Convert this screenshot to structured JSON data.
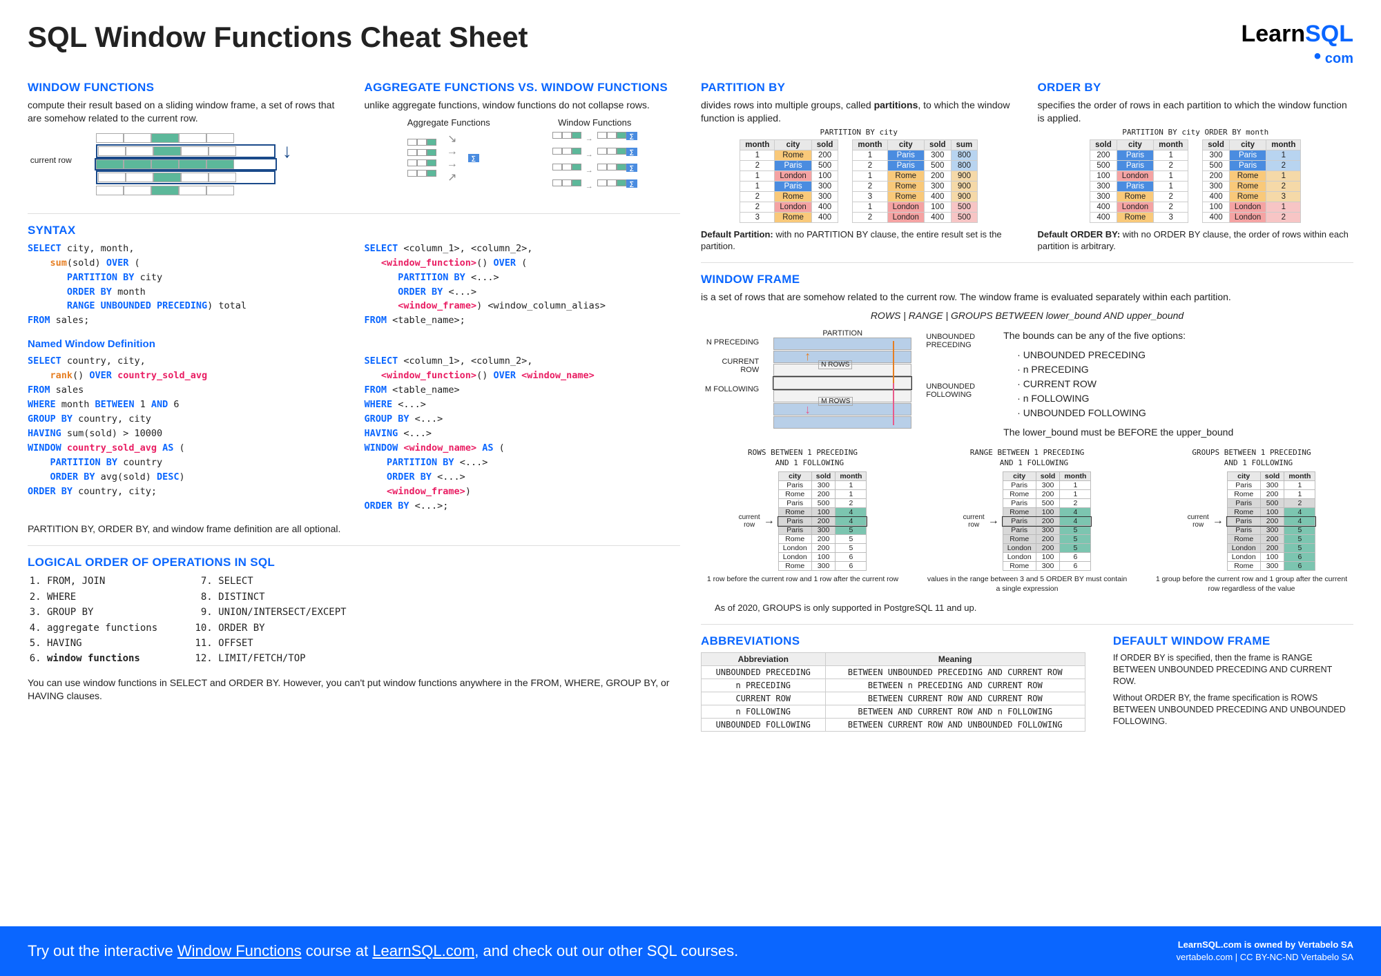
{
  "title": "SQL Window Functions Cheat Sheet",
  "logo": {
    "learn": "Learn",
    "sql": "SQL",
    "com": ".com"
  },
  "wf": {
    "heading": "WINDOW FUNCTIONS",
    "desc": "compute their result based on a sliding window frame, a set of rows that are somehow related to the current row.",
    "current_row": "current row"
  },
  "agg": {
    "heading": "AGGREGATE FUNCTIONS VS. WINDOW FUNCTIONS",
    "desc": "unlike aggregate functions, window functions do not collapse rows.",
    "agg_title": "Aggregate Functions",
    "win_title": "Window Functions"
  },
  "syntax": {
    "heading": "SYNTAX",
    "named_heading": "Named Window Definition",
    "note": "PARTITION BY, ORDER BY, and window frame definition are all optional."
  },
  "logical": {
    "heading": "LOGICAL ORDER OF OPERATIONS IN SQL",
    "ops1": [
      "FROM, JOIN",
      "WHERE",
      "GROUP BY",
      "aggregate functions",
      "HAVING",
      "window functions"
    ],
    "ops2": [
      "SELECT",
      "DISTINCT",
      "UNION/INTERSECT/EXCEPT",
      "ORDER BY",
      "OFFSET",
      "LIMIT/FETCH/TOP"
    ],
    "note": "You can use window functions in SELECT and ORDER BY. However, you can't put window functions anywhere in the FROM, WHERE, GROUP BY, or HAVING clauses."
  },
  "partition": {
    "heading": "PARTITION BY",
    "desc_pre": "divides rows into multiple groups, called ",
    "desc_bold": "partitions",
    "desc_post": ", to which the window function is applied.",
    "caption": "PARTITION BY city",
    "t1_head": [
      "month",
      "city",
      "sold"
    ],
    "t1_rows": [
      [
        "1",
        "Rome",
        "200"
      ],
      [
        "2",
        "Paris",
        "500"
      ],
      [
        "1",
        "London",
        "100"
      ],
      [
        "1",
        "Paris",
        "300"
      ],
      [
        "2",
        "Rome",
        "300"
      ],
      [
        "2",
        "London",
        "400"
      ],
      [
        "3",
        "Rome",
        "400"
      ]
    ],
    "t2_head": [
      "month",
      "city",
      "sold",
      "sum"
    ],
    "t2_rows": [
      [
        "1",
        "Paris",
        "300",
        "800"
      ],
      [
        "2",
        "Paris",
        "500",
        "800"
      ],
      [
        "1",
        "Rome",
        "200",
        "900"
      ],
      [
        "2",
        "Rome",
        "300",
        "900"
      ],
      [
        "3",
        "Rome",
        "400",
        "900"
      ],
      [
        "1",
        "London",
        "100",
        "500"
      ],
      [
        "2",
        "London",
        "400",
        "500"
      ]
    ],
    "default_b": "Default Partition:",
    "default_t": " with no PARTITION BY clause, the entire result set is the partition."
  },
  "orderby": {
    "heading": "ORDER BY",
    "desc": "specifies the order of rows in each partition to which the window function is applied.",
    "caption": "PARTITION BY city ORDER BY month",
    "t1_head": [
      "sold",
      "city",
      "month"
    ],
    "t1_rows": [
      [
        "200",
        "Paris",
        "1"
      ],
      [
        "500",
        "Paris",
        "2"
      ],
      [
        "100",
        "London",
        "1"
      ],
      [
        "300",
        "Paris",
        "1"
      ],
      [
        "300",
        "Rome",
        "2"
      ],
      [
        "400",
        "London",
        "2"
      ],
      [
        "400",
        "Rome",
        "3"
      ]
    ],
    "t2_rows": [
      [
        "300",
        "Paris",
        "1"
      ],
      [
        "500",
        "Paris",
        "2"
      ],
      [
        "200",
        "Rome",
        "1"
      ],
      [
        "300",
        "Rome",
        "2"
      ],
      [
        "400",
        "Rome",
        "3"
      ],
      [
        "100",
        "London",
        "1"
      ],
      [
        "400",
        "London",
        "2"
      ]
    ],
    "default_b": "Default ORDER BY:",
    "default_t": " with no ORDER BY clause, the order of rows within each partition is arbitrary."
  },
  "frame": {
    "heading": "WINDOW FRAME",
    "desc": "is a set of rows that are somehow related to the current row. The window frame is evaluated separately within each partition.",
    "syntax_line": "ROWS | RANGE | GROUPS BETWEEN lower_bound AND upper_bound",
    "bounds_intro": "The bounds can be any of the five options:",
    "bounds": [
      "UNBOUNDED PRECEDING",
      "n PRECEDING",
      "CURRENT ROW",
      "n FOLLOWING",
      "UNBOUNDED FOLLOWING"
    ],
    "bounds_note": "The lower_bound must be BEFORE the upper_bound",
    "diag_labels": {
      "partition": "PARTITION",
      "unb_prec": "UNBOUNDED\nPRECEDING",
      "n_prec": "N PRECEDING",
      "nrows": "N ROWS",
      "current": "CURRENT\nROW",
      "mrows": "M ROWS",
      "m_fol": "M FOLLOWING",
      "unb_fol": "UNBOUNDED\nFOLLOWING"
    },
    "ex_head": [
      "city",
      "sold",
      "month"
    ],
    "ex_rows": [
      [
        "Paris",
        "300",
        "1"
      ],
      [
        "Rome",
        "200",
        "1"
      ],
      [
        "Paris",
        "500",
        "2"
      ],
      [
        "Rome",
        "100",
        "4"
      ],
      [
        "Paris",
        "200",
        "4"
      ],
      [
        "Paris",
        "300",
        "5"
      ],
      [
        "Rome",
        "200",
        "5"
      ],
      [
        "London",
        "200",
        "5"
      ],
      [
        "London",
        "100",
        "6"
      ],
      [
        "Rome",
        "300",
        "6"
      ]
    ],
    "current_row_label": "current\nrow",
    "rows_title": "ROWS BETWEEN 1 PRECEDING\n   AND 1 FOLLOWING",
    "rows_note": "1 row before the current row and 1 row after the current row",
    "range_title": "RANGE BETWEEN 1 PRECEDING\n   AND 1 FOLLOWING",
    "range_note": "values in the range between 3 and 5 ORDER BY must contain a single expression",
    "groups_title": "GROUPS BETWEEN 1 PRECEDING\n   AND 1 FOLLOWING",
    "groups_note": "1 group before the current row and 1 group after the current row regardless of the value",
    "asof": "As of 2020, GROUPS is only supported in PostgreSQL 11 and up."
  },
  "abbrev": {
    "heading": "ABBREVIATIONS",
    "head": [
      "Abbreviation",
      "Meaning"
    ],
    "rows": [
      [
        "UNBOUNDED PRECEDING",
        "BETWEEN UNBOUNDED PRECEDING AND CURRENT ROW"
      ],
      [
        "n PRECEDING",
        "BETWEEN n PRECEDING AND CURRENT ROW"
      ],
      [
        "CURRENT ROW",
        "BETWEEN CURRENT ROW AND CURRENT ROW"
      ],
      [
        "n FOLLOWING",
        "BETWEEN AND CURRENT ROW AND n FOLLOWING"
      ],
      [
        "UNBOUNDED FOLLOWING",
        "BETWEEN CURRENT ROW AND UNBOUNDED FOLLOWING"
      ]
    ]
  },
  "default_frame": {
    "heading": "DEFAULT WINDOW FRAME",
    "p1": "If ORDER BY is specified, then the frame is RANGE BETWEEN UNBOUNDED PRECEDING AND CURRENT ROW.",
    "p2": "Without ORDER BY, the frame specification is ROWS BETWEEN UNBOUNDED PRECEDING AND UNBOUNDED FOLLOWING."
  },
  "footer": {
    "left_pre": "Try out the interactive ",
    "left_link1": "Window Functions",
    "left_mid": " course at ",
    "left_link2": "LearnSQL.com",
    "left_post": ", and check out our other SQL courses.",
    "r1": "LearnSQL.com is owned by Vertabelo SA",
    "r2": "vertabelo.com | CC BY-NC-ND Vertabelo SA"
  }
}
